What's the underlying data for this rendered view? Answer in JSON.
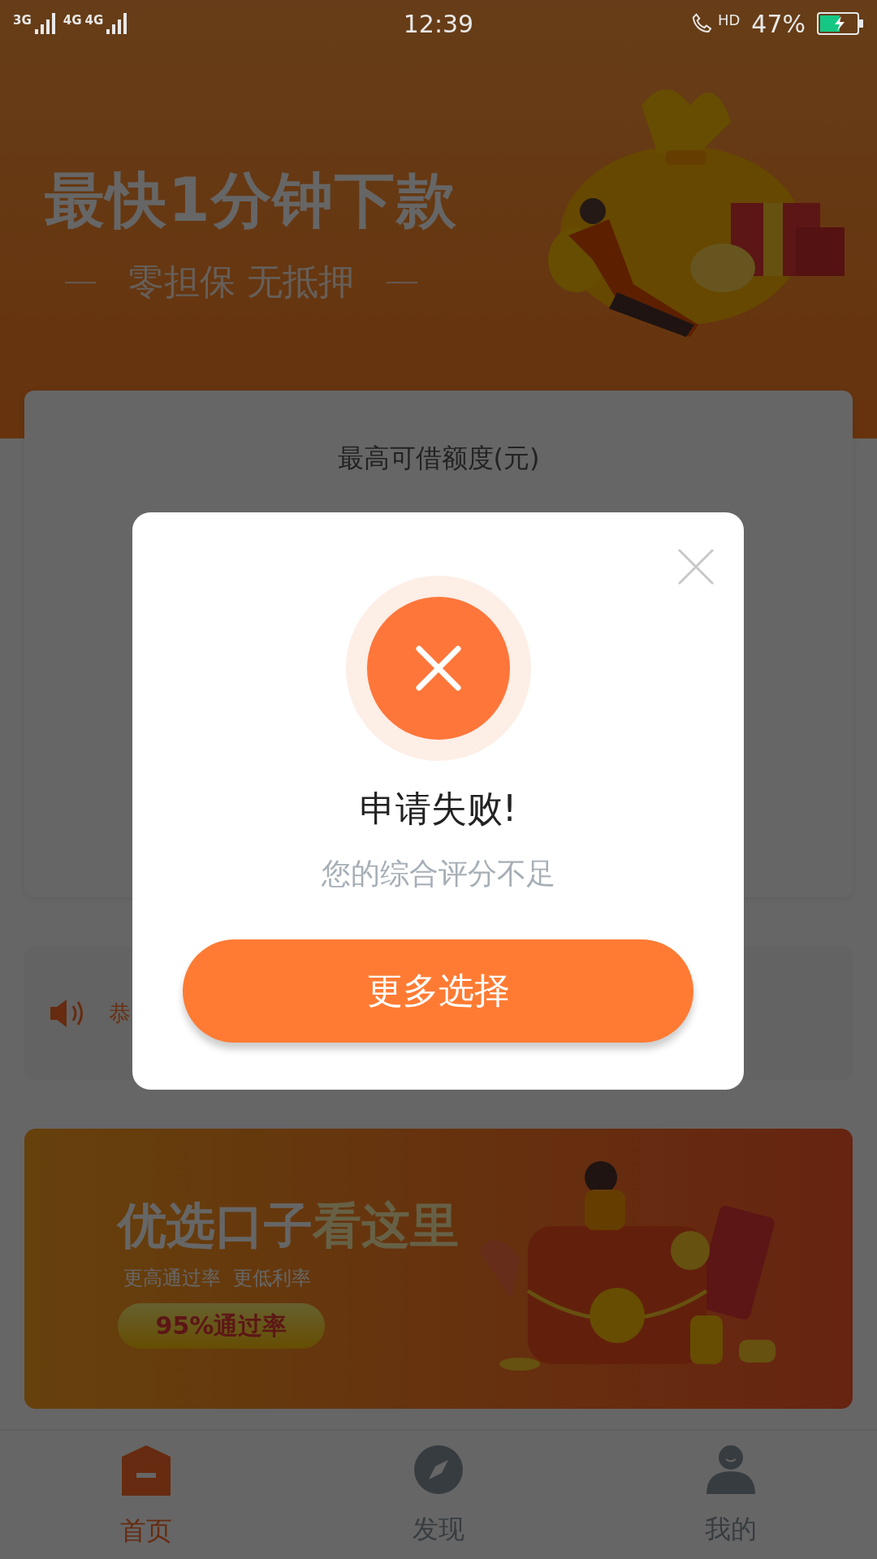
{
  "status_bar": {
    "network_1": "3G",
    "network_2": "4G",
    "network_3": "4G",
    "time": "12:39",
    "call_badge": "HD",
    "battery": "47%"
  },
  "hero": {
    "title": "最快1分钟下款",
    "subtitle": "零担保 无抵押"
  },
  "limit_card": {
    "label": "最高可借额度(元)"
  },
  "notice": {
    "text": "恭"
  },
  "promo": {
    "title": "优选口子",
    "title_highlight": "看这里",
    "subtitle": "更高通过率  更低利率",
    "badge": "95%通过率"
  },
  "tabs": [
    {
      "kind": "home",
      "label": "首页",
      "selected": true
    },
    {
      "kind": "discover",
      "label": "发现",
      "selected": false
    },
    {
      "kind": "profile",
      "label": "我的",
      "selected": false
    }
  ],
  "dialog": {
    "title": "申请失败!",
    "message": "您的综合评分不足",
    "button": "更多选择"
  }
}
